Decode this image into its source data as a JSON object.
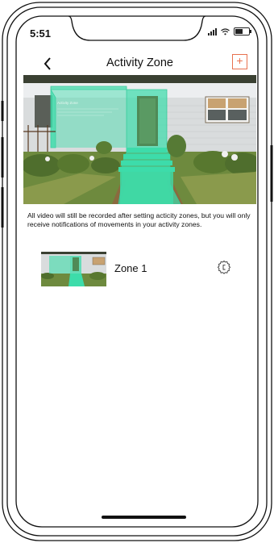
{
  "status_bar": {
    "time": "5:51"
  },
  "nav": {
    "title": "Activity Zone",
    "add_label": "+"
  },
  "camera": {
    "overlay_title": "Activity Zone"
  },
  "info": {
    "text": "All video will still be recorded after setting acticity zones, but you will only receive notifications of movements in your activity zones."
  },
  "zones": [
    {
      "label": "Zone 1"
    }
  ],
  "icons": {
    "back": "chevron-left-icon",
    "add": "plus-icon",
    "settings": "gear-icon",
    "signal": "signal-icon",
    "wifi": "wifi-icon",
    "battery": "battery-icon"
  },
  "colors": {
    "accent": "#e8714f",
    "zone_overlay": "#3ddcaa"
  }
}
